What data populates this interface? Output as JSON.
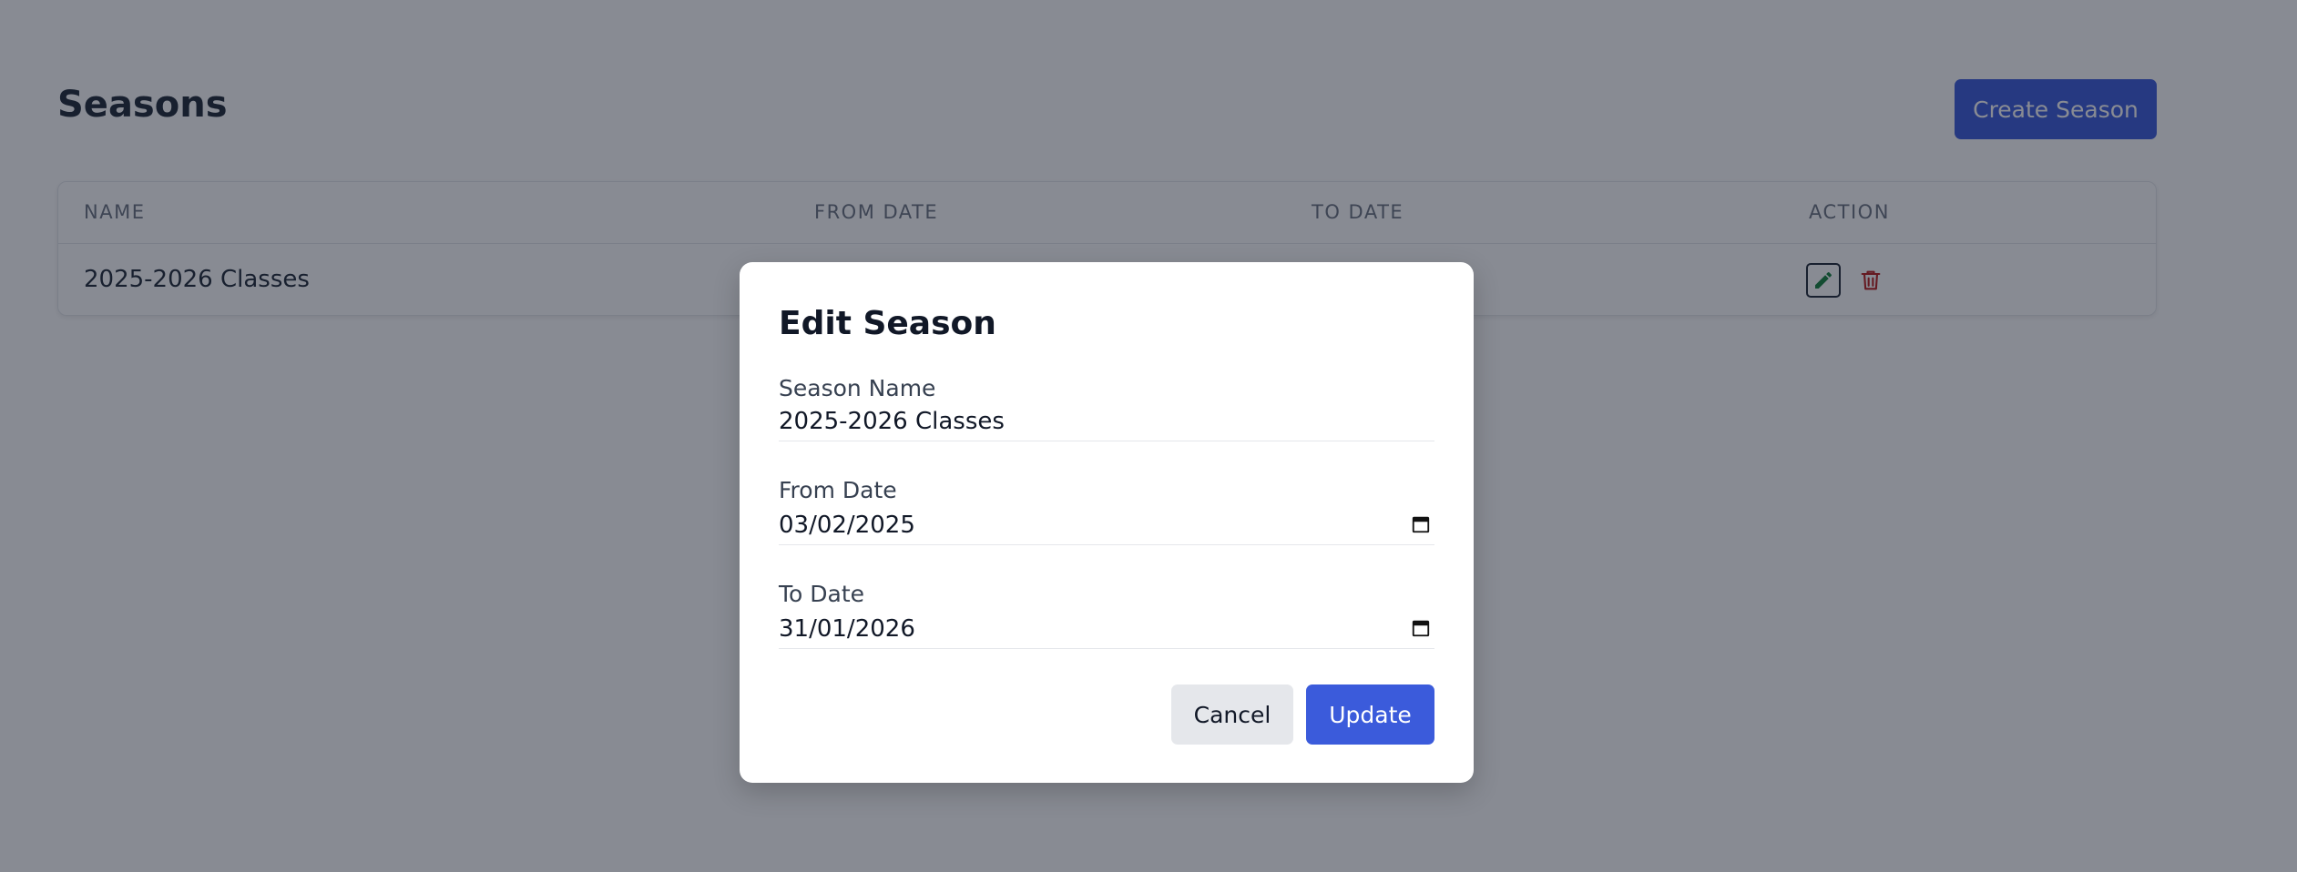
{
  "page": {
    "title": "Seasons",
    "create_button": "Create Season"
  },
  "table": {
    "columns": [
      "NAME",
      "FROM DATE",
      "TO DATE",
      "ACTION"
    ],
    "rows": [
      {
        "name": "2025-2026 Classes",
        "actions": [
          "edit-icon",
          "trash-icon"
        ]
      }
    ]
  },
  "modal": {
    "title": "Edit Season",
    "season_name_label": "Season Name",
    "season_name_value": "2025-2026 Classes",
    "from_date_label": "From Date",
    "from_date_value": "03/02/2025",
    "to_date_label": "To Date",
    "to_date_value": "31/01/2026",
    "cancel_label": "Cancel",
    "update_label": "Update"
  },
  "colors": {
    "primary": "#3b5bdb",
    "edit_icon": "#15803d",
    "delete_icon": "#b91c1c",
    "overlay": "rgba(17,24,39,0.5)"
  }
}
